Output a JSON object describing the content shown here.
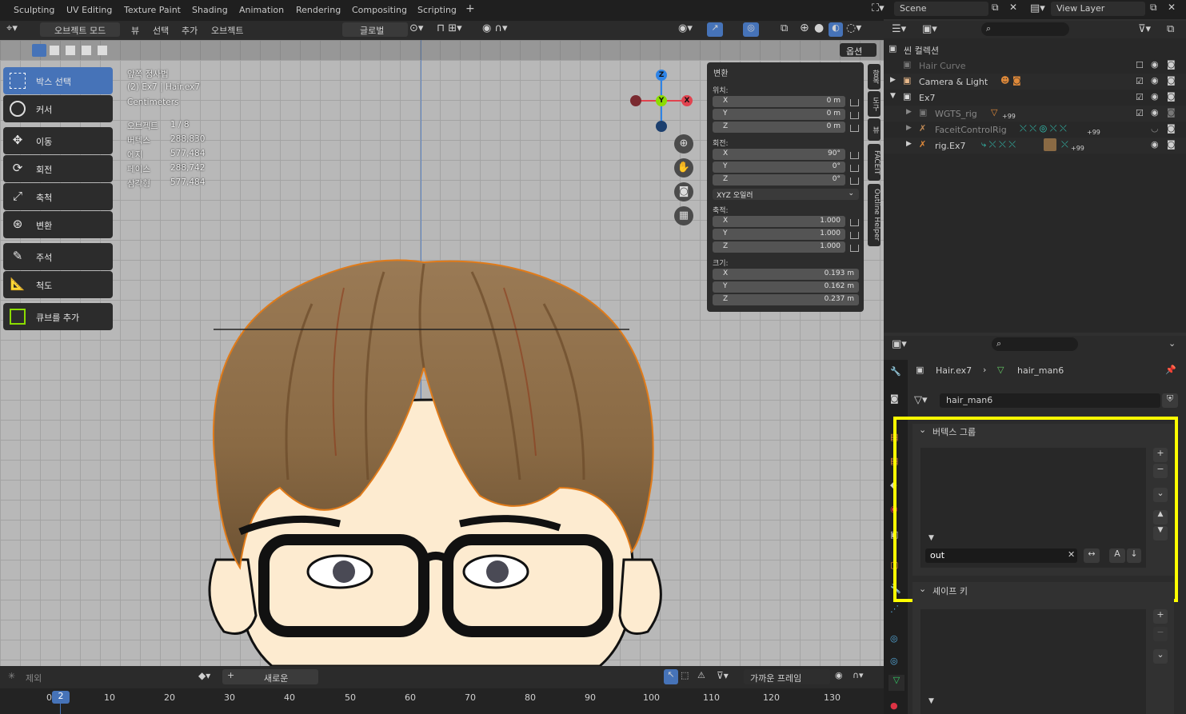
{
  "workspace_tabs": [
    "Sculpting",
    "UV Editing",
    "Texture Paint",
    "Shading",
    "Animation",
    "Rendering",
    "Compositing",
    "Scripting",
    "+"
  ],
  "scene": {
    "name": "Scene",
    "view_layer": "View Layer"
  },
  "header": {
    "mode": "오브젝트 모드",
    "menus": [
      "뷰",
      "선택",
      "추가",
      "오브젝트"
    ],
    "transform_orientation": "글로벌",
    "options": "옵션"
  },
  "toolbar": [
    {
      "label": "박스 선택",
      "icon": "box-select-icon",
      "active": true
    },
    {
      "label": "커서",
      "icon": "cursor-icon"
    },
    {
      "label": "이동",
      "icon": "move-icon"
    },
    {
      "label": "회전",
      "icon": "rotate-icon"
    },
    {
      "label": "축척",
      "icon": "scale-icon"
    },
    {
      "label": "변환",
      "icon": "transform-icon"
    },
    {
      "label": "주석",
      "icon": "annotate-icon"
    },
    {
      "label": "척도",
      "icon": "measure-icon"
    },
    {
      "label": "큐브를 추가",
      "icon": "add-cube-icon"
    }
  ],
  "viewport_info": {
    "view": "앞쪽 정사법",
    "object": "(2) Ex7 | Hair.ex7",
    "units": "Centimeters",
    "stats": [
      [
        "오브젝트",
        "1 / 8"
      ],
      [
        "버텍스",
        "288,830"
      ],
      [
        "에지",
        "577,484"
      ],
      [
        "페이스",
        "288,742"
      ],
      [
        "삼각형",
        "577,484"
      ]
    ]
  },
  "transform_panel": {
    "title": "변환",
    "location_label": "위치:",
    "location": [
      [
        "X",
        "0 m"
      ],
      [
        "Y",
        "0 m"
      ],
      [
        "Z",
        "0 m"
      ]
    ],
    "rotation_label": "회전:",
    "rotation": [
      [
        "X",
        "90°"
      ],
      [
        "Y",
        "0°"
      ],
      [
        "Z",
        "0°"
      ]
    ],
    "rotation_mode": "XYZ 오일러",
    "scale_label": "축적:",
    "scale": [
      [
        "X",
        "1.000"
      ],
      [
        "Y",
        "1.000"
      ],
      [
        "Z",
        "1.000"
      ]
    ],
    "dimensions_label": "크기:",
    "dimensions": [
      [
        "X",
        "0.193 m"
      ],
      [
        "Y",
        "0.162 m"
      ],
      [
        "Z",
        "0.237 m"
      ]
    ]
  },
  "side_tabs": [
    "항목",
    "도구",
    "뷰",
    "FACEIT",
    "Outline Helper"
  ],
  "outliner": {
    "root": "씬 컬렉션",
    "rows": [
      {
        "name": "Hair Curve",
        "indent": 0,
        "dim": true
      },
      {
        "name": "Camera & Light",
        "indent": 0
      },
      {
        "name": "Ex7",
        "indent": 0
      },
      {
        "name": "WGTS_rig",
        "indent": 1,
        "dim": true,
        "badge": "+99"
      },
      {
        "name": "FaceitControlRig",
        "indent": 1,
        "dim": true,
        "badge": "+99"
      },
      {
        "name": "rig.Ex7",
        "indent": 1,
        "badge": "+99"
      }
    ]
  },
  "properties": {
    "breadcrumb_object": "Hair.ex7",
    "breadcrumb_data": "hair_man6",
    "data_name": "hair_man6",
    "vertex_groups_title": "버텍스 그룹",
    "filter_value": "out",
    "shape_keys_title": "셰이프 키"
  },
  "timeline": {
    "exclude_label": "제외",
    "new_label": "새로운",
    "snap_label": "가까운 프레임",
    "current_frame": "2",
    "ticks": [
      "0",
      "10",
      "20",
      "30",
      "40",
      "50",
      "60",
      "70",
      "80",
      "90",
      "100",
      "110",
      "120",
      "130"
    ]
  },
  "colors": {
    "accent": "#4673b8",
    "highlight": "#ffff00",
    "x_axis": "#e1434f",
    "y_axis": "#8bdc00",
    "z_axis": "#2f84e6"
  }
}
